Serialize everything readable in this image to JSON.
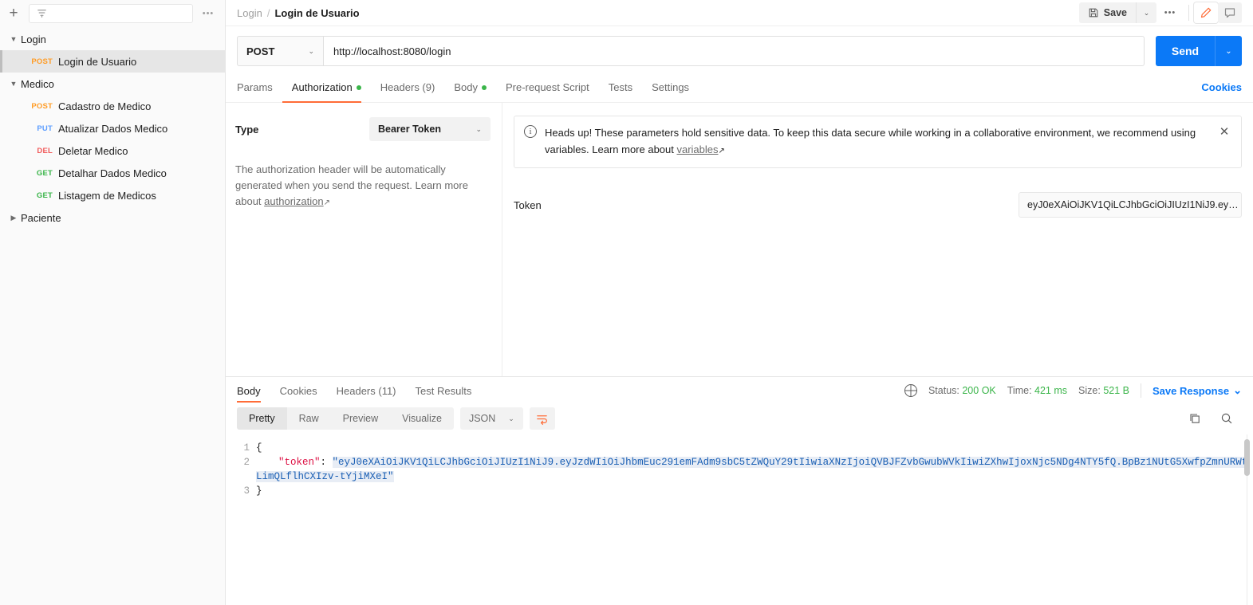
{
  "sidebar": {
    "toolbar": {
      "add_label": "+",
      "filter_placeholder": "",
      "more_label": "•••"
    },
    "tree": [
      {
        "type": "folder",
        "label": "Login",
        "expanded": true,
        "chevron": "chevron-down-icon"
      },
      {
        "type": "request",
        "method": "POST",
        "label": "Login de Usuario",
        "active": true
      },
      {
        "type": "folder",
        "label": "Medico",
        "expanded": true,
        "chevron": "chevron-down-icon"
      },
      {
        "type": "request",
        "method": "POST",
        "label": "Cadastro de Medico",
        "active": false
      },
      {
        "type": "request",
        "method": "PUT",
        "label": "Atualizar Dados Medico",
        "active": false
      },
      {
        "type": "request",
        "method": "DEL",
        "label": "Deletar Medico",
        "active": false
      },
      {
        "type": "request",
        "method": "GET",
        "label": "Detalhar Dados Medico",
        "active": false
      },
      {
        "type": "request",
        "method": "GET",
        "label": "Listagem de Medicos",
        "active": false
      },
      {
        "type": "folder",
        "label": "Paciente",
        "expanded": false,
        "chevron": "chevron-right-icon"
      }
    ]
  },
  "header": {
    "breadcrumb_root": "Login",
    "breadcrumb_sep": "/",
    "breadcrumb_current": "Login de Usuario",
    "save_label": "Save",
    "save_caret": "⌄",
    "more_label": "•••",
    "edit_icon": "pencil-icon",
    "comment_icon": "comment-icon"
  },
  "request": {
    "method": "POST",
    "method_caret": "⌄",
    "url": "http://localhost:8080/login",
    "send_label": "Send",
    "send_caret": "⌄",
    "tabs": [
      {
        "label": "Params",
        "active": false,
        "dot": false
      },
      {
        "label": "Authorization",
        "active": true,
        "dot": true
      },
      {
        "label": "Headers (9)",
        "active": false,
        "dot": false
      },
      {
        "label": "Body",
        "active": false,
        "dot": true
      },
      {
        "label": "Pre-request Script",
        "active": false,
        "dot": false
      },
      {
        "label": "Tests",
        "active": false,
        "dot": false
      },
      {
        "label": "Settings",
        "active": false,
        "dot": false
      }
    ],
    "cookies_link": "Cookies"
  },
  "authorization": {
    "type_label": "Type",
    "type_value": "Bearer Token",
    "type_caret": "⌄",
    "description_part1": "The authorization header will be automatically generated when you send the request. Learn more about ",
    "description_link": "authorization",
    "link_arrow": "↗",
    "notice": {
      "icon": "info-icon",
      "text_part1": "Heads up! These parameters hold sensitive data. To keep this data secure while working in a collaborative environment, we recommend using variables. Learn more about ",
      "link": "variables",
      "link_arrow": "↗",
      "close_icon": "close-icon"
    },
    "token_label": "Token",
    "token_value": "eyJ0eXAiOiJKV1QiLCJhbGciOiJIUzI1NiJ9.ey…"
  },
  "response": {
    "tabs": [
      {
        "label": "Body",
        "active": true
      },
      {
        "label": "Cookies",
        "active": false
      },
      {
        "label": "Headers (11)",
        "active": false
      },
      {
        "label": "Test Results",
        "active": false
      }
    ],
    "globe_icon": "globe-icon",
    "status_label": "Status:",
    "status_value": "200 OK",
    "time_label": "Time:",
    "time_value": "421 ms",
    "size_label": "Size:",
    "size_value": "521 B",
    "save_response_label": "Save Response",
    "save_response_caret": "⌄",
    "view_modes": [
      {
        "label": "Pretty",
        "active": true
      },
      {
        "label": "Raw",
        "active": false
      },
      {
        "label": "Preview",
        "active": false
      },
      {
        "label": "Visualize",
        "active": false
      }
    ],
    "format_value": "JSON",
    "format_caret": "⌄",
    "wrap_icon": "word-wrap-icon",
    "copy_icon": "copy-icon",
    "search_icon": "search-icon",
    "body_lines": [
      "1",
      "2",
      "3"
    ],
    "body": {
      "line1": "{",
      "line2_key": "\"token\"",
      "line2_colon": ": ",
      "line2_value": "\"eyJ0eXAiOiJKV1QiLCJhbGciOiJIUzI1NiJ9.eyJzdWIiOiJhbmEuc291emFAdm9sbC5tZWQuY29tIiwiaXNzIjoiQVBJFZvbGwubWVkIiwiZXhwIjoxNjc5NDg4NTY5fQ.BpBz1NUtG5XwfpZmnURWtLimQLflhCXIzv-tYjiMXeI\"",
      "line3": "}"
    }
  },
  "colors": {
    "accent_orange": "#ff6c37",
    "link_blue": "#0b79f7",
    "status_green": "#3bb54a",
    "method_post": "#ff9d28",
    "method_put": "#5e9eff",
    "method_delete": "#f15b5b",
    "method_get": "#3bb54a"
  }
}
